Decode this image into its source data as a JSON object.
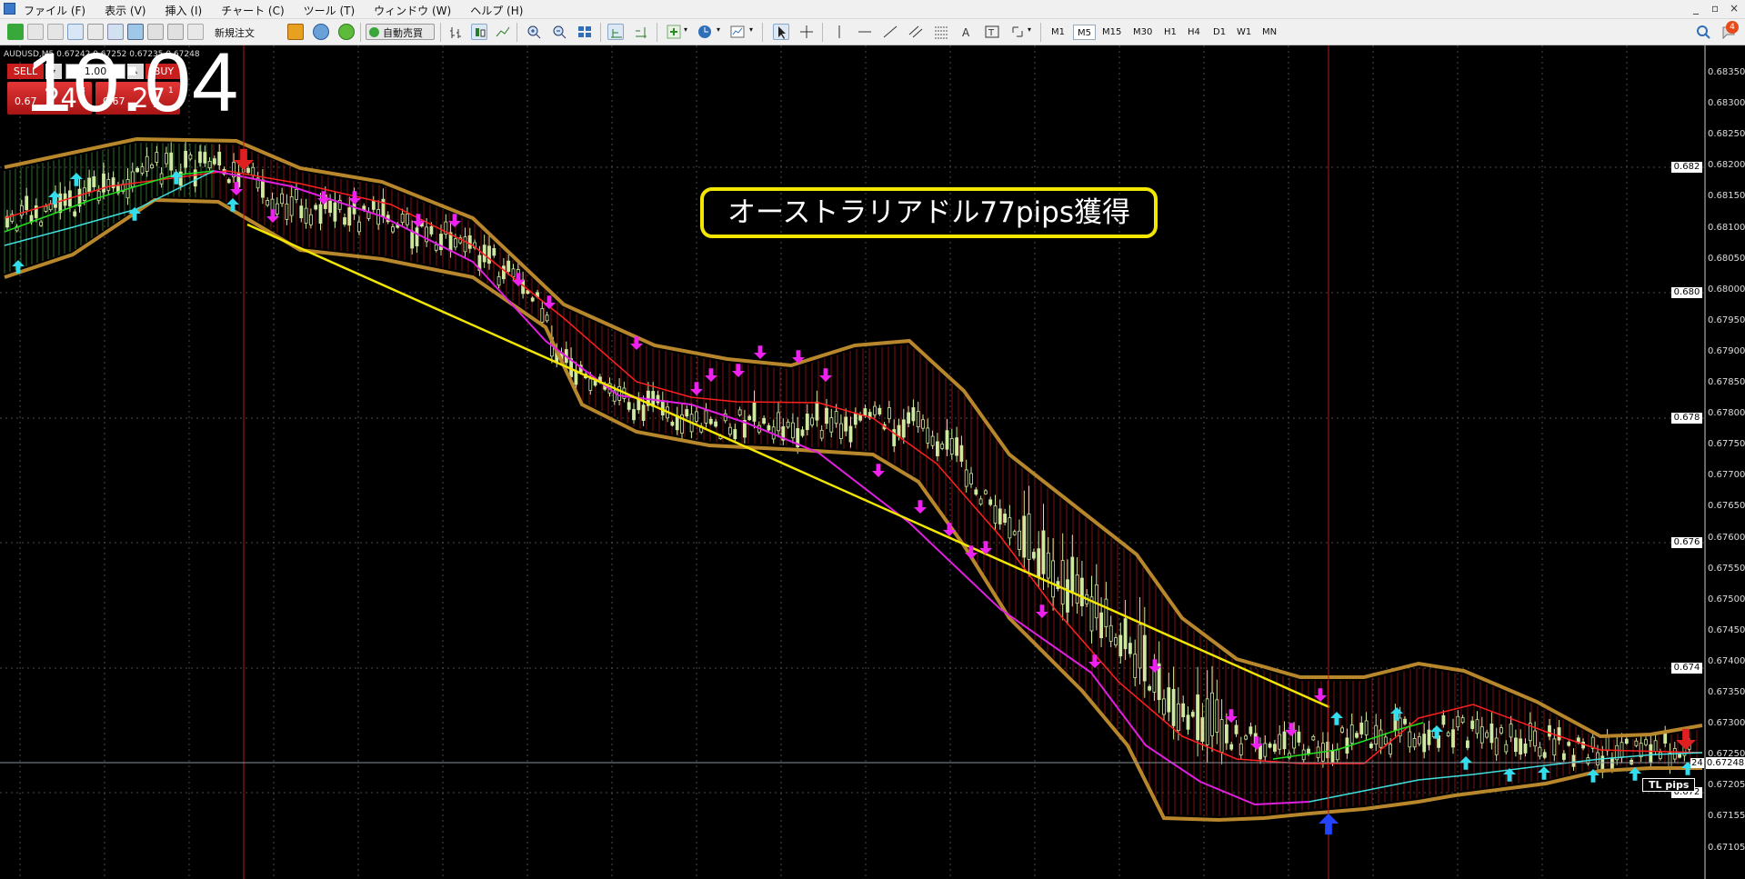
{
  "menu": {
    "items": [
      "ファイル (F)",
      "表示 (V)",
      "挿入 (I)",
      "チャート (C)",
      "ツール (T)",
      "ウィンドウ (W)",
      "ヘルプ (H)"
    ],
    "window_controls": [
      "_",
      "▫",
      "×"
    ]
  },
  "toolbar": {
    "new_order_label": "新規注文",
    "autotrade_label": "自動売買",
    "timeframes": [
      "M1",
      "M5",
      "M15",
      "M30",
      "H1",
      "H4",
      "D1",
      "W1",
      "MN"
    ],
    "active_timeframe": "M5",
    "notification_count": "4"
  },
  "chart": {
    "symbol_text": "AUDUSD,M5  0.67242 0.67252 0.67235 0.67248",
    "sell_label": "SELL",
    "buy_label": "BUY",
    "lot_value": "1.00",
    "sell_price_prefix": "0.67",
    "sell_price_big": "24",
    "sell_price_sup": "8",
    "buy_price_prefix": "0.67",
    "buy_price_big": "27",
    "buy_price_sup": "1",
    "clock": "10:04",
    "annotation": "オーストラリアドル77pips獲得",
    "trendline_label": "TL pips",
    "current_price": "0.67248",
    "bid_tag": "24"
  },
  "price_axis": {
    "labels": [
      "0.68350",
      "0.68300",
      "0.68250",
      "0.68200",
      "0.68150",
      "0.68100",
      "0.68050",
      "0.68000",
      "0.67950",
      "0.67900",
      "0.67850",
      "0.67800",
      "0.67750",
      "0.67700",
      "0.67650",
      "0.67600",
      "0.67550",
      "0.67500",
      "0.67450",
      "0.67400",
      "0.67350",
      "0.67300",
      "0.67250",
      "0.67205",
      "0.67155",
      "0.67105"
    ],
    "round_boxes": [
      "0.682",
      "0.680",
      "0.678",
      "0.676",
      "0.674",
      "0.672"
    ]
  },
  "colors": {
    "background": "#000000",
    "band": "#b8862b",
    "red_ma": "#ff2020",
    "magenta_ma": "#e020e0",
    "green_ma": "#20e020",
    "cyan_ma": "#40e0e0",
    "trendline": "#f3e600",
    "buy_arrow": "#33ddee",
    "sell_arrow": "#ee22ee"
  }
}
